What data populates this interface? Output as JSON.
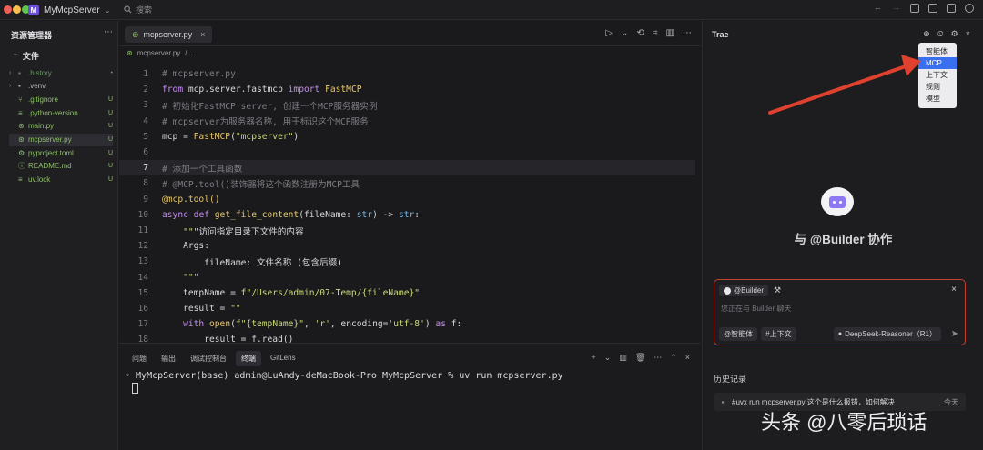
{
  "titlebar": {
    "project_initial": "M",
    "project_name": "MyMcpServer",
    "project_chevron": "⌄",
    "search_label": "搜索"
  },
  "sidebar": {
    "title": "资源管理器",
    "more": "⋯",
    "section": "文件",
    "files": [
      {
        "name": ".history",
        "type": "folder",
        "status": "•",
        "color": "#6c8f6a"
      },
      {
        "name": ".venv",
        "type": "folder",
        "status": "",
        "color": "#b8b8be"
      },
      {
        "name": ".gitignore",
        "type": "git",
        "status": "U",
        "color": "#8fbf6a"
      },
      {
        "name": ".python-version",
        "type": "file",
        "status": "U",
        "color": "#8fbf6a"
      },
      {
        "name": "main.py",
        "type": "py",
        "status": "U",
        "color": "#8fbf6a"
      },
      {
        "name": "mcpserver.py",
        "type": "py",
        "status": "U",
        "color": "#8fbf6a"
      },
      {
        "name": "pyproject.toml",
        "type": "toml",
        "status": "U",
        "color": "#8fbf6a"
      },
      {
        "name": "README.md",
        "type": "info",
        "status": "U",
        "color": "#8fbf6a"
      },
      {
        "name": "uv.lock",
        "type": "file",
        "status": "U",
        "color": "#8fbf6a"
      }
    ]
  },
  "editor": {
    "tab_label": "mcpserver.py",
    "tab_close": "×",
    "breadcrumb": "mcpserver.py",
    "breadcrumb_more": "/ …",
    "actions": [
      "▷",
      "⌄",
      "⟲",
      "⌗",
      "▥",
      "⋯"
    ],
    "lines": [
      {
        "n": "1",
        "text": "# mcpserver.py"
      },
      {
        "n": "2",
        "text": "from mcp.server.fastmcp import FastMCP"
      },
      {
        "n": "3",
        "text": "# 初始化FastMCP server, 创建一个MCP服务器实例"
      },
      {
        "n": "4",
        "text": "# mcpserver为服务器名称, 用于标识这个MCP服务"
      },
      {
        "n": "5",
        "text": "mcp = FastMCP(\"mcpserver\")"
      },
      {
        "n": "6",
        "text": ""
      },
      {
        "n": "7",
        "text": "# 添加一个工具函数"
      },
      {
        "n": "8",
        "text": "# @MCP.tool()装饰器将这个函数注册为MCP工具"
      },
      {
        "n": "9",
        "text": "@mcp.tool()"
      },
      {
        "n": "10",
        "text": "async def get_file_content(fileName: str) -> str:"
      },
      {
        "n": "11",
        "text": "    \"\"\"访问指定目录下文件的内容"
      },
      {
        "n": "12",
        "text": "    Args:"
      },
      {
        "n": "13",
        "text": "        fileName: 文件名称 (包含后缀)"
      },
      {
        "n": "14",
        "text": "    \"\"\""
      },
      {
        "n": "15",
        "text": "    tempName = f\"/Users/admin/07-Temp/{fileName}\""
      },
      {
        "n": "16",
        "text": "    result = \"\""
      },
      {
        "n": "17",
        "text": "    with open(f\"{tempName}\", 'r', encoding='utf-8') as f:"
      },
      {
        "n": "18",
        "text": "        result = f.read()"
      }
    ]
  },
  "panel": {
    "tabs": [
      "问题",
      "输出",
      "调试控制台",
      "终端",
      "GitLens"
    ],
    "actions": [
      "+",
      "⌄",
      "▥",
      "🗑",
      "⋯",
      "⌃",
      "×"
    ],
    "terminal_prompt": "◦ MyMcpServer(base) admin@LuAndy-deMacBook-Pro MyMcpServer % uv run mcpserver.py"
  },
  "right": {
    "title": "Trae",
    "icons": [
      "⊕",
      "⏲",
      "⚙",
      "×"
    ],
    "menu": [
      "智能体",
      "MCP",
      "上下文",
      "规则",
      "模型"
    ],
    "collab": "与 @Builder 协作",
    "chip_label": "@Builder",
    "chip_tool": "⚒",
    "close": "×",
    "placeholder": "您正在与 Builder 聊天",
    "btn_agent": "@智能体",
    "btn_context": "#上下文",
    "model": "DeepSeek-Reasoner（R1）",
    "send": "➤",
    "history_title": "历史记录",
    "history_item": "#uvx run mcpserver.py 这个是什么报错，如何解决",
    "history_time": "今天"
  },
  "watermark": "头条 @八零后琐话",
  "colors": {
    "accent": "#3a6ff0",
    "annotation": "#e0402e"
  }
}
